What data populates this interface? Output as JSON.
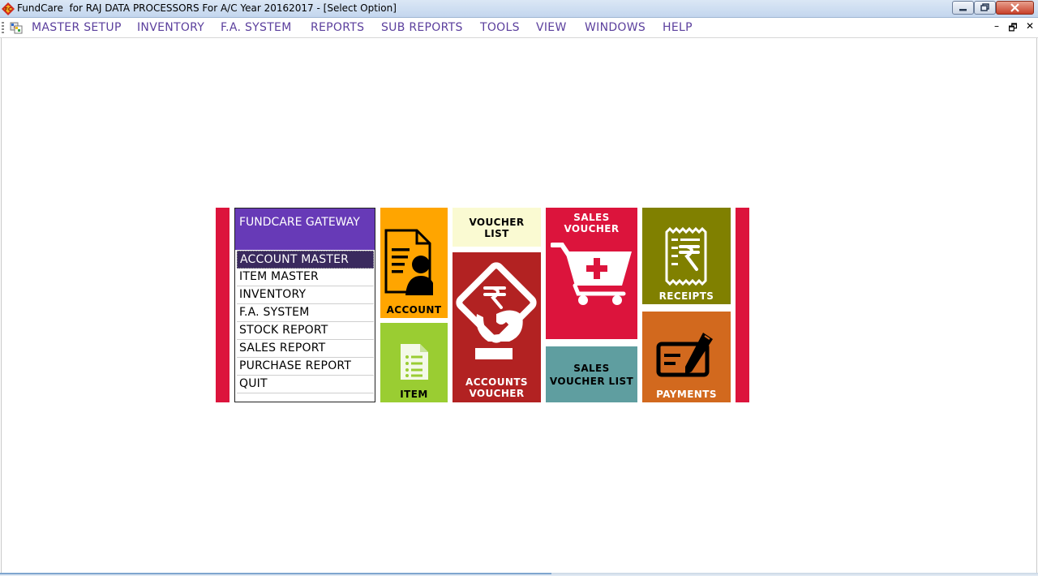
{
  "window": {
    "title": "FundCare  for RAJ DATA PROCESSORS For A/C Year 20162017 - [Select Option]"
  },
  "menubar": {
    "items": [
      "MASTER SETUP",
      "INVENTORY",
      "F.A. SYSTEM",
      "REPORTS",
      "SUB REPORTS",
      "TOOLS",
      "VIEW",
      "WINDOWS",
      "HELP"
    ],
    "mdi_min": "–",
    "mdi_restore": "🗗",
    "mdi_close": "✕"
  },
  "gateway": {
    "title": "FUNDCARE GATEWAY",
    "items": [
      "ACCOUNT MASTER",
      "ITEM MASTER",
      "INVENTORY",
      "F.A. SYSTEM",
      "STOCK REPORT",
      "SALES REPORT",
      "PURCHASE REPORT",
      "QUIT"
    ],
    "selected_index": 0
  },
  "tiles": {
    "account": {
      "label": "ACCOUNT",
      "color": "#ffa500",
      "icon": "account-document-icon"
    },
    "item": {
      "label": "ITEM",
      "color": "#9acd32",
      "icon": "item-list-icon"
    },
    "voucher_list": {
      "label": "VOUCHER\nLIST",
      "color": "#fafad2",
      "icon": ""
    },
    "accounts_voucher": {
      "label": "ACCOUNTS\nVOUCHER",
      "color": "#b22222",
      "icon": "rupee-voucher-icon"
    },
    "sales_voucher": {
      "label": "SALES\nVOUCHER",
      "color": "#dc143c",
      "icon": "shopping-cart-icon"
    },
    "sales_voucher_list": {
      "label": "SALES\nVOUCHER LIST",
      "color": "#5f9ea0",
      "icon": ""
    },
    "receipts": {
      "label": "RECEIPTS",
      "color": "#808000",
      "icon": "rupee-receipt-icon"
    },
    "payments": {
      "label": "PAYMENTS",
      "color": "#d2691e",
      "icon": "cheque-pen-icon"
    }
  },
  "colors": {
    "accent_purple": "#673ab7",
    "menu_text": "#5b3f9d",
    "side_bar_red": "#dc143c"
  }
}
